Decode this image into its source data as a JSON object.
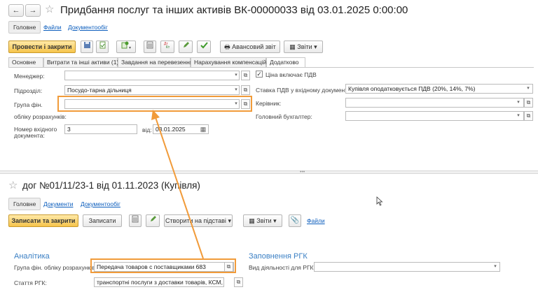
{
  "doc1": {
    "title": "Придбання послуг та інших активів ВК-00000033 від 03.01.2025 0:00:00",
    "nav": {
      "back": "←",
      "forward": "→"
    },
    "tabs": [
      "Головне",
      "Файли",
      "Документообіг"
    ],
    "toolbar": {
      "post_close": "Провести і закрити",
      "advance_report": "Авансовий звіт",
      "reports": "Звіти"
    },
    "page_tabs": [
      "Основне",
      "Витрати та інші активи (1)",
      "Завдання на перевезення",
      "Нарахування компенсацій",
      "Додатково"
    ],
    "left": {
      "manager_label": "Менеджер:",
      "manager_value": "",
      "division_label": "Підрозділ:",
      "division_value": "Посудо-тарна дільниця",
      "group_label_1": "Група фін.",
      "group_label_2": "обліку розрахунків:",
      "group_value": "",
      "incoming_label_1": "Номер вхідного",
      "incoming_label_2": "документа:",
      "incoming_value": "3",
      "date_label": "від:",
      "date_value": "03.01.2025"
    },
    "right": {
      "vat_included": "Ціна включає ПДВ",
      "vat_rate_label": "Ставка ПДВ у вхідному документі:",
      "vat_rate_value": "Купівля оподатковується ПДВ (20%, 14%, 7%)",
      "head_label": "Керівник:",
      "head_value": "",
      "accountant_label": "Головний бухгалтер:",
      "accountant_value": ""
    }
  },
  "doc2": {
    "title": "дог №01/11/23-1 від 01.11.2023 (Купівля)",
    "tabs": [
      "Головне",
      "Документи",
      "Документообіг"
    ],
    "toolbar": {
      "save_close": "Записати та закрити",
      "save": "Записати",
      "create_based": "Створити на підставі",
      "reports": "Звіти",
      "files": "Файли"
    },
    "analytics": {
      "title": "Аналітика",
      "group_label": "Група фін. обліку розрахунків:",
      "group_value": "Передача товаров с поставщиками 683",
      "article_label": "Стаття РГК:",
      "article_value": "транспортні послуги з доставки товарів, КСМ, сир"
    },
    "rgk": {
      "title": "Заповнення РГК",
      "activity_label": "Вид діяльності для РГК:",
      "activity_value": ""
    }
  },
  "colors": {
    "accent": "#f6c44b",
    "highlight": "#f19b3a",
    "link": "#0b5dbd"
  }
}
